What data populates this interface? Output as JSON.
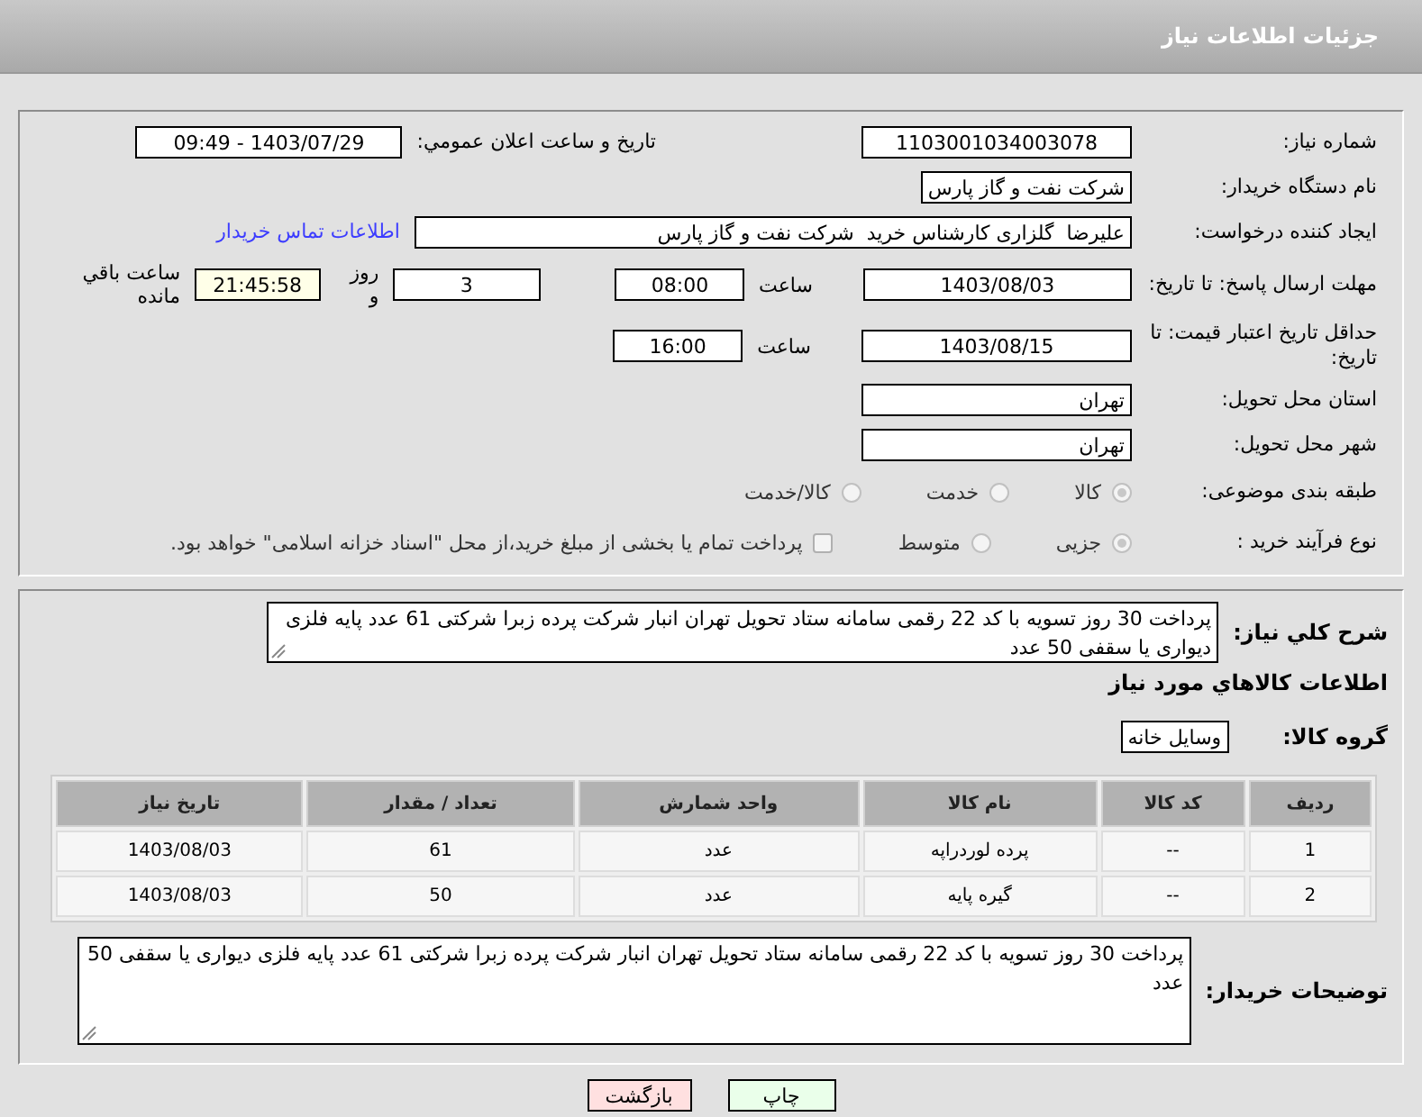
{
  "header": {
    "title": "جزئیات اطلاعات نیاز"
  },
  "need_number": {
    "label": "شماره نیاز:",
    "value": "1103001034003078"
  },
  "announce": {
    "label": "تاریخ و ساعت اعلان عمومي:",
    "value": "1403/07/29 - 09:49"
  },
  "buyer": {
    "label": "نام دستگاه خریدار:",
    "value": "شرکت نفت و گاز پارس"
  },
  "creator": {
    "label": "ایجاد کننده درخواست:",
    "value": "علیرضا  گلزاری کارشناس خرید  شرکت نفت و گاز پارس",
    "link": "اطلاعات تماس خریدار"
  },
  "deadline": {
    "label": "مهلت ارسال پاسخ: تا تاریخ:",
    "date": "1403/08/03",
    "time_label": "ساعت",
    "time": "08:00",
    "days": "3",
    "days_label": "روز و",
    "remaining": "21:45:58",
    "remaining_label": "ساعت باقي مانده"
  },
  "validity": {
    "label": "حداقل تاریخ اعتبار قیمت: تا تاریخ:",
    "date": "1403/08/15",
    "time_label": "ساعت",
    "time": "16:00"
  },
  "province": {
    "label": "استان محل تحویل:",
    "value": "تهران"
  },
  "city": {
    "label": "شهر محل تحویل:",
    "value": "تهران"
  },
  "category": {
    "label": "طبقه بندی موضوعی:",
    "options": [
      {
        "label": "کالا",
        "selected": true
      },
      {
        "label": "خدمت",
        "selected": false
      },
      {
        "label": "کالا/خدمت",
        "selected": false
      }
    ]
  },
  "purchase_type": {
    "label": "نوع فرآیند خرید :",
    "options": [
      {
        "label": "جزیی",
        "selected": true
      },
      {
        "label": "متوسط",
        "selected": false
      }
    ],
    "treasury": {
      "label": "پرداخت تمام یا بخشی از مبلغ خرید،از محل \"اسناد خزانه اسلامی\" خواهد بود.",
      "checked": false
    }
  },
  "description": {
    "label": "شرح کلي نیاز:",
    "value": "پرداخت 30 روز تسویه با کد 22 رقمی سامانه ستاد تحویل تهران انبار شرکت پرده زبرا شرکتی 61 عدد پایه فلزی دیواری یا سقفی 50 عدد"
  },
  "goods_heading": "اطلاعات کالاهاي مورد نیاز",
  "goods_group": {
    "label": "گروه کالا:",
    "value": "وسایل خانه"
  },
  "table": {
    "columns": [
      "ردیف",
      "کد کالا",
      "نام کالا",
      "واحد شمارش",
      "تعداد / مقدار",
      "تاریخ نیاز"
    ],
    "rows": [
      [
        "1",
        "--",
        "پرده لوردراپه",
        "عدد",
        "61",
        "1403/08/03"
      ],
      [
        "2",
        "--",
        "گیره پایه",
        "عدد",
        "50",
        "1403/08/03"
      ]
    ]
  },
  "buyer_notes": {
    "label": "توضیحات خریدار:",
    "value": "پرداخت 30 روز تسویه با کد 22 رقمی سامانه ستاد تحویل تهران انبار شرکت پرده زبرا شرکتی 61 عدد پایه فلزی دیواری یا سقفی 50 عدد"
  },
  "buttons": [
    {
      "label": "چاپ",
      "kind": "print"
    },
    {
      "label": "بازگشت",
      "kind": "back"
    }
  ]
}
